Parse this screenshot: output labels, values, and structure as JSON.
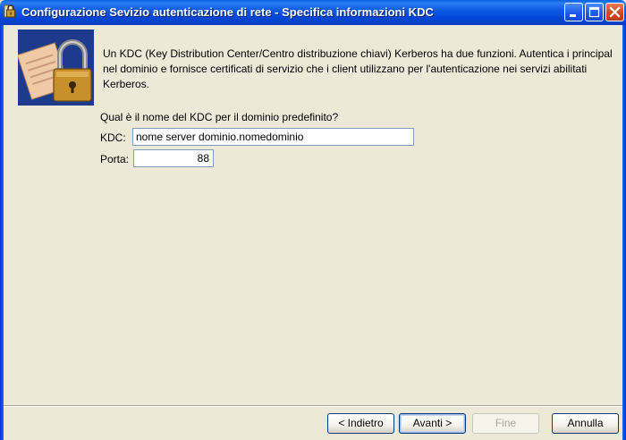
{
  "window": {
    "title": "Configurazione Sevizio autenticazione di rete - Specifica informazioni KDC"
  },
  "intro": {
    "text": "Un KDC (Key Distribution Center/Centro distribuzione chiavi) Kerberos ha due funzioni. Autentica i principal nel dominio e fornisce certificati di servizio che i client utilizzano per l'autenticazione nei servizi abilitati Kerberos."
  },
  "form": {
    "question": "Qual è il nome del KDC per il dominio predefinito?",
    "kdc_label": "KDC:",
    "kdc_value": "nome server dominio.nomedominio",
    "port_label": "Porta:",
    "port_value": "88"
  },
  "buttons": {
    "back": "< Indietro",
    "next": "Avanti >",
    "finish": "Fine",
    "cancel": "Annulla"
  },
  "icons": {
    "title": "key-lock-icon",
    "main": "padlock-certificate-icon",
    "minimize": "minimize-icon",
    "maximize": "maximize-icon",
    "close": "close-icon"
  },
  "colors": {
    "titlebar": "#0a5fe0",
    "dialog_background": "#ece9d8",
    "image_background": "#1e3a8c"
  }
}
